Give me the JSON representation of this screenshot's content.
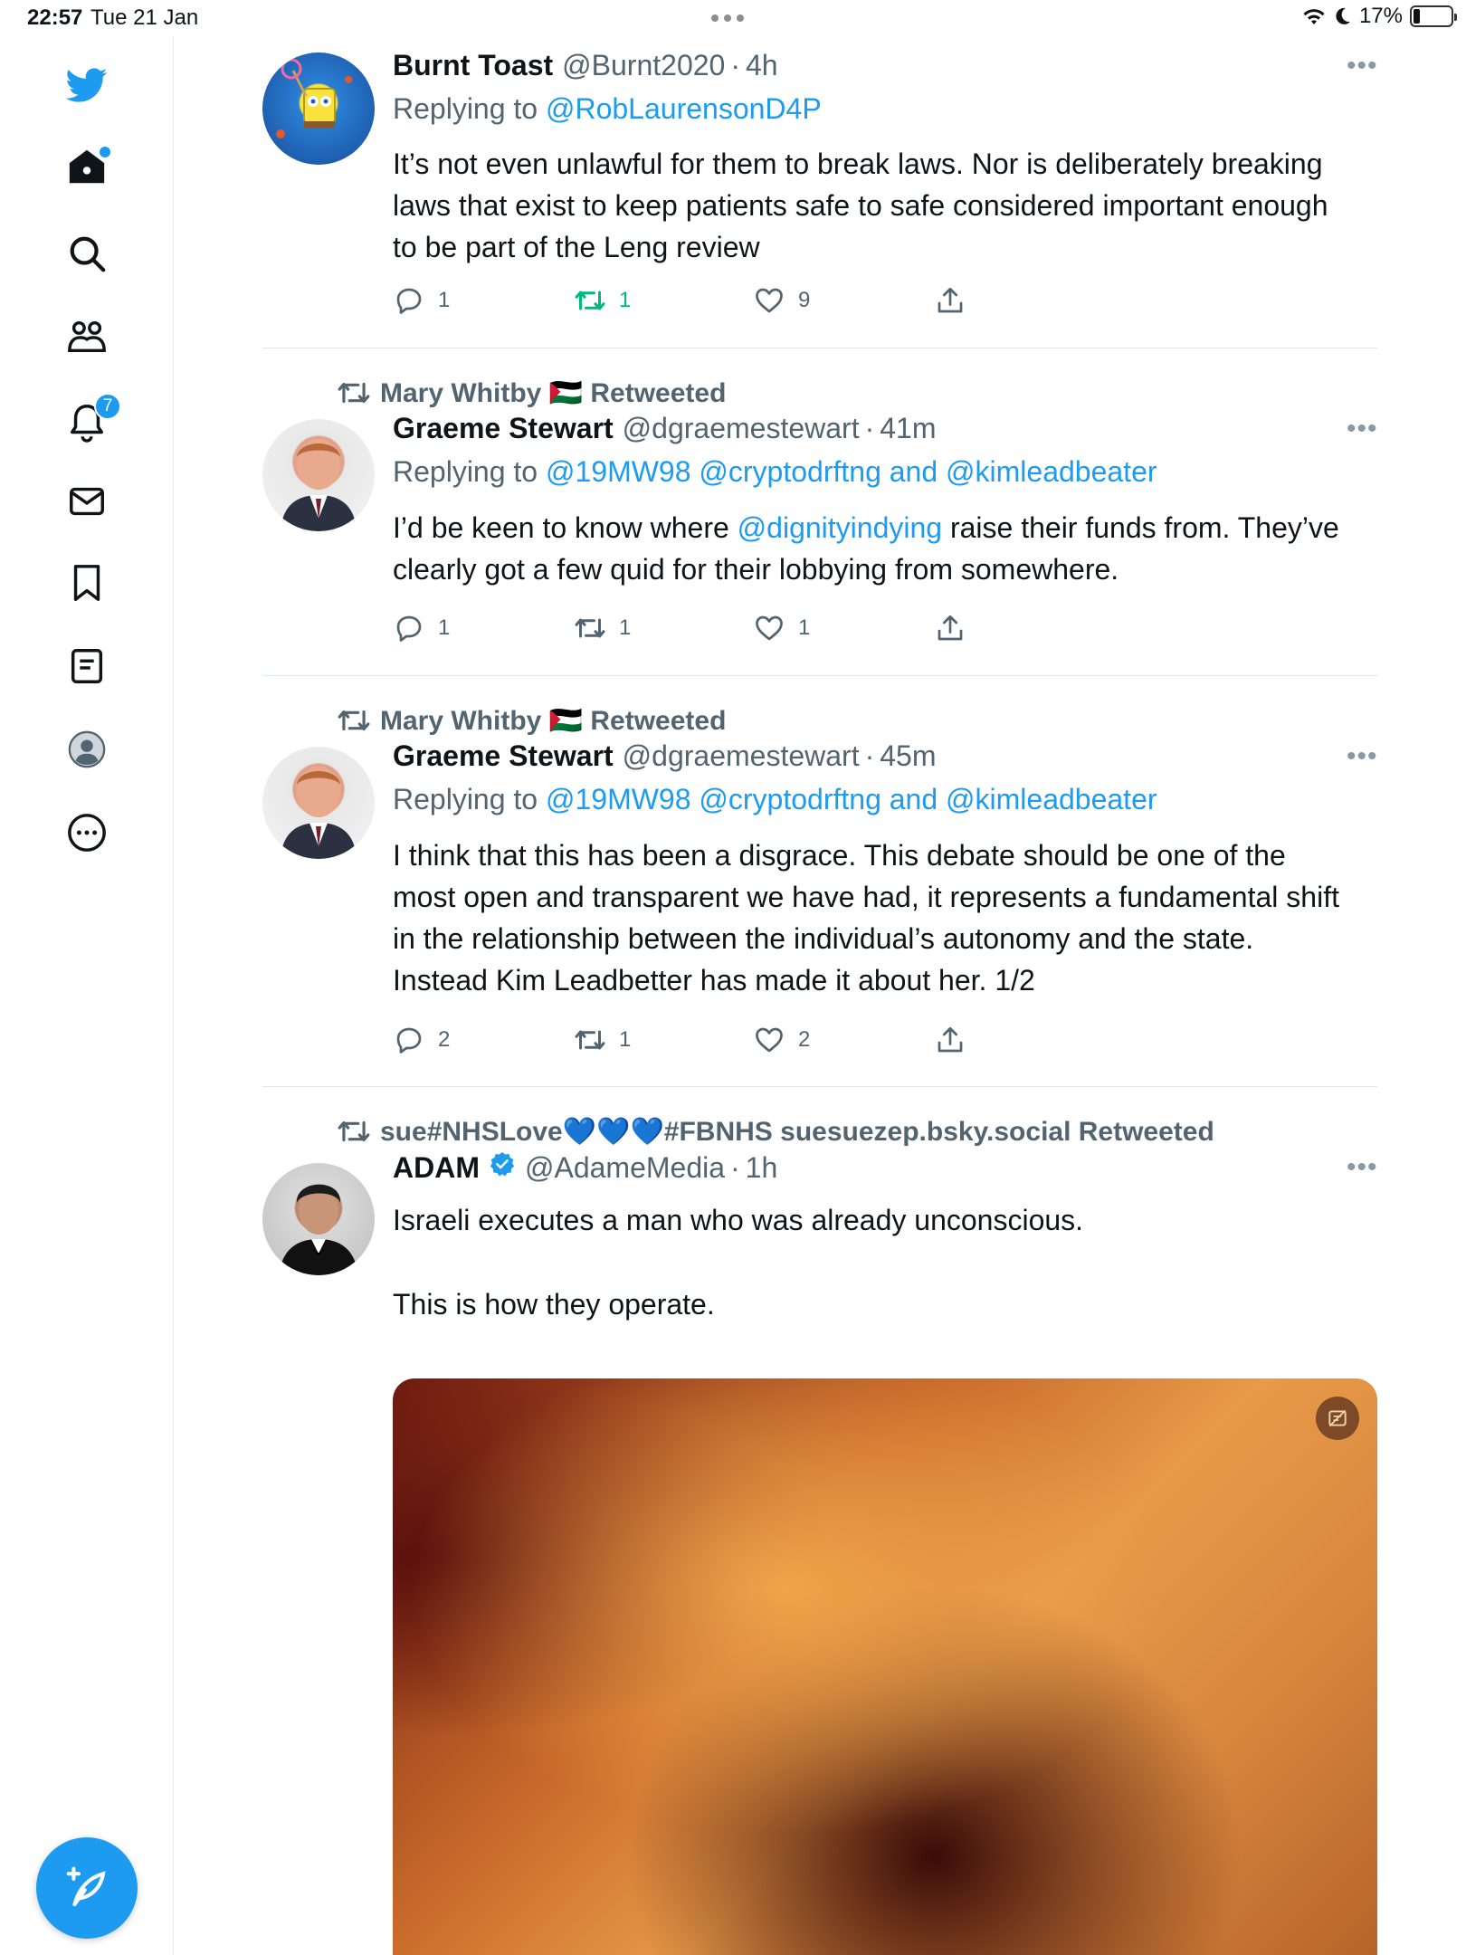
{
  "status_bar": {
    "time": "22:57",
    "date": "Tue 21 Jan",
    "battery": "17%",
    "battery_level": 0.17
  },
  "sidebar": {
    "items": [
      {
        "name": "twitter-logo",
        "icon": "bird-icon"
      },
      {
        "name": "home",
        "icon": "home-icon"
      },
      {
        "name": "search",
        "icon": "search-icon"
      },
      {
        "name": "communities",
        "icon": "people-icon"
      },
      {
        "name": "notifications",
        "icon": "bell-icon",
        "badge": "7"
      },
      {
        "name": "messages",
        "icon": "mail-icon"
      },
      {
        "name": "bookmarks",
        "icon": "bookmark-icon"
      },
      {
        "name": "lists",
        "icon": "list-icon"
      },
      {
        "name": "profile",
        "icon": "profile-icon"
      },
      {
        "name": "more",
        "icon": "more-circle-icon"
      }
    ],
    "compose_icon": "compose-feather-icon"
  },
  "colors": {
    "accent": "#1d9bf0",
    "secondary_text": "#536471",
    "retweet_green": "#00ba7c"
  },
  "tweets": [
    {
      "name": "Burnt Toast",
      "handle": "@Burnt2020",
      "time": "4h",
      "replying_label": "Replying to",
      "replying_to": "@RobLaurensonD4P",
      "text": "It’s not even unlawful for them to break laws. Nor is deliberately breaking laws that exist to keep patients safe to safe considered important enough to be part of the Leng review",
      "replies": "1",
      "retweets": "1",
      "likes": "9"
    },
    {
      "retweeted_by": "Mary Whitby 🇵🇸 Retweeted",
      "name": "Graeme Stewart",
      "handle": "@dgraemestewart",
      "time": "41m",
      "replying_label": "Replying to",
      "replying_to": "@19MW98 @cryptodrftng and @kimleadbeater",
      "text_pre": "I’d be keen to know where ",
      "text_mention": "@dignityindying",
      "text_post": " raise their funds from. They’ve clearly got a few quid for their lobbying from somewhere.",
      "replies": "1",
      "retweets": "1",
      "likes": "1"
    },
    {
      "retweeted_by": "Mary Whitby 🇵🇸 Retweeted",
      "name": "Graeme Stewart",
      "handle": "@dgraemestewart",
      "time": "45m",
      "replying_label": "Replying to",
      "replying_to": "@19MW98 @cryptodrftng and @kimleadbeater",
      "text": "I think that this has been a disgrace. This debate should be one of the most open and transparent we have had, it represents a fundamental shift in the relationship between the individual’s autonomy and the state. Instead Kim Leadbetter has made it about her. 1/2",
      "replies": "2",
      "retweets": "1",
      "likes": "2"
    },
    {
      "retweeted_by": "sue#NHSLove💙💙💙#FBNHS suesuezep.bsky.social Retweeted",
      "name": "ADAM",
      "handle": "@AdameMedia",
      "time": "1h",
      "text_line1": "Israeli executes a man who was already unconscious.",
      "text_line2": "This is how they operate."
    }
  ],
  "more_label": "•••",
  "dot_sep": "·"
}
